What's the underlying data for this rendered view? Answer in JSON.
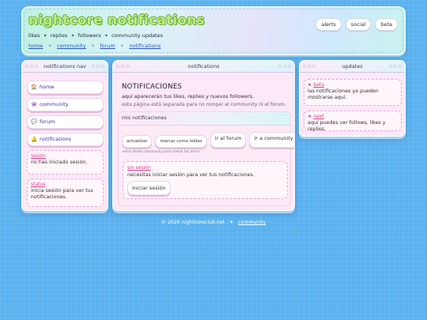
{
  "header": {
    "logo": "nightcore notifications",
    "tagline": [
      "likes",
      "replies",
      "followers",
      "community updates"
    ],
    "tagline_sep": "✦",
    "breadcrumbs": [
      "home",
      "community",
      "forum",
      "notifications"
    ],
    "breadcrumb_sep": "✦",
    "top_links": [
      "alerts",
      "social",
      "beta"
    ]
  },
  "nav": {
    "title": "notifications nav",
    "items": [
      {
        "icon": "🏠",
        "label": "home"
      },
      {
        "icon": "👾",
        "label": "community"
      },
      {
        "icon": "💬",
        "label": "forum"
      },
      {
        "icon": "🔔",
        "label": "notifications"
      }
    ],
    "session": {
      "heading": "sesión",
      "text": "no has iniciado sesión."
    },
    "status": {
      "heading": "status",
      "text": "inicia sesión para ver tus notificaciones."
    }
  },
  "main": {
    "title": "notifications",
    "heading": "NOTIFICACIONES",
    "description": "aquí aparecerán tus likes, replies y nuevos followers.",
    "note": "esta página está separada para no romper el community ni el forum.",
    "panel": {
      "title": "mis notificaciones",
      "actions": [
        "actualizar",
        "marcar como leídas",
        "ir al forum",
        "ir a community"
      ],
      "note": "entra desde community para revisar tus alerts",
      "signin": {
        "heading": "sin sesión",
        "text": "necesitas iniciar sesión para ver tus notificaciones.",
        "button": "iniciar sesión"
      }
    }
  },
  "updates": {
    "title": "updates",
    "items": [
      {
        "star": "★",
        "heading": "beta",
        "text": "las notificaciones ya pueden mostrarse aquí."
      },
      {
        "star": "★",
        "heading": "next",
        "text": "aquí puedes ver follows, likes y replies."
      }
    ]
  },
  "footer": {
    "copyright": "© 2026 nightcoreclub.net",
    "sep": "✦",
    "link": "community"
  }
}
